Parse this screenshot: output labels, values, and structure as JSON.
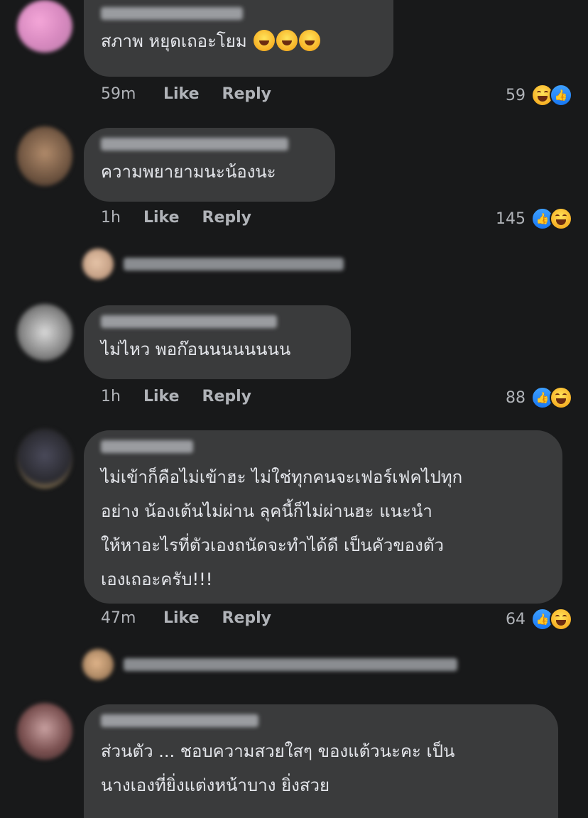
{
  "comments": [
    {
      "text": "สภาพ หยุดเถอะโยม",
      "inline_emoji": "rolling-laughing-emoji",
      "time": "59m",
      "like_label": "Like",
      "reply_label": "Reply",
      "reaction_count": "59",
      "reactions": [
        "laugh",
        "like"
      ]
    },
    {
      "text": "ความพยายามนะน้องนะ",
      "time": "1h",
      "like_label": "Like",
      "reply_label": "Reply",
      "reaction_count": "145",
      "reactions": [
        "like",
        "laugh"
      ]
    },
    {
      "text": "ไม่ไหว พอก๊อนนนนนนนน",
      "time": "1h",
      "like_label": "Like",
      "reply_label": "Reply",
      "reaction_count": "88",
      "reactions": [
        "like",
        "laugh"
      ]
    },
    {
      "text": "ไม่เข้าก็คือไม่เข้าฮะ ไม่ใช่ทุกคนจะเฟอร์เฟคไปทุก\nอย่าง น้องเต้นไม่ผ่าน ลุคนี้ก็ไม่ผ่านฮะ แนะนำ\nให้หาอะไรที่ตัวเองถนัดจะทำได้ดี เป็นคัวของตัว\nเองเถอะครับ!!!",
      "time": "47m",
      "like_label": "Like",
      "reply_label": "Reply",
      "reaction_count": "64",
      "reactions": [
        "like",
        "laugh"
      ]
    },
    {
      "text": "ส่วนตัว ... ชอบความสวยใสๆ ของแต้วนะคะ เป็น\nนางเองที่ยิ่งแต่งหน้าบาง ยิ่งสวย"
    }
  ],
  "colors": {
    "background": "#18191a",
    "bubble": "#3a3b3c",
    "text": "#e4e6eb",
    "meta": "#b0b3b8",
    "like_blue": "#1877f2",
    "laugh_yellow": "#f7b125"
  }
}
